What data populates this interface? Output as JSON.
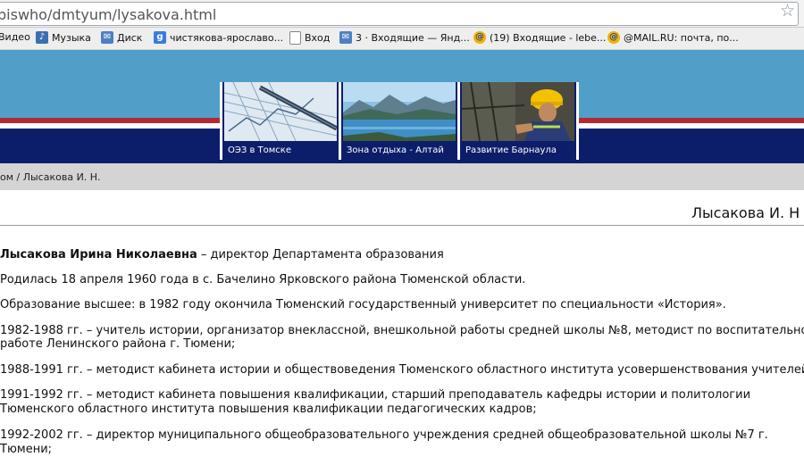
{
  "browser": {
    "url": "biswho/dmtyum/lysakova.html",
    "bookmarks": [
      {
        "label": "Видео",
        "icon": "video-icon"
      },
      {
        "label": "Музыка",
        "icon": "music-icon"
      },
      {
        "label": "Диск",
        "icon": "mail-icon"
      },
      {
        "label": "чистякова-ярославо...",
        "icon": "google-icon"
      },
      {
        "label": "Вход",
        "icon": "page-icon"
      },
      {
        "label": "3 · Входящие — Янд...",
        "icon": "mail-icon"
      },
      {
        "label": "(19) Входящие - lebe...",
        "icon": "at-icon"
      },
      {
        "label": "@MAIL.RU: почта, по...",
        "icon": "at-icon"
      }
    ]
  },
  "header": {
    "tiles": [
      {
        "caption": "ОЭЗ в Томске"
      },
      {
        "caption": "Зона отдыха - Алтай"
      },
      {
        "caption": "Развитие Барнаула"
      }
    ]
  },
  "breadcrumb": "ом / Лысакова И. Н.",
  "page": {
    "title": "Лысакова И. Н",
    "intro_name": "Лысакова Ирина Николаевна",
    "intro_rest": " – директор Департамента образования",
    "p1": "Родилась 18 апреля 1960 года в с. Бачелино Ярковского района Тюменской области.",
    "p2": "Образование высшее: в 1982 году окончила Тюменский государственный университет по специальности «История».",
    "p3a": "1982-1988 гг. – учитель истории, организатор внеклассной, внешкольной работы средней школы №8, методист по воспитательной",
    "p3b": "работе Ленинского района г. Тюмени;",
    "p4": "1988-1991 гг. – методист кабинета истории и обществоведения Тюменского областного института усовершенствования учителей;",
    "p5a": "1991-1992 гг. – методист кабинета повышения квалификации, старший преподаватель кафедры истории и политологии",
    "p5b": "Тюменского областного института повышения квалификации педагогических кадров;",
    "p6a": "1992-2002 гг. – директор муниципального общеобразовательного учреждения средней общеобразовательной школы №7 г.",
    "p6b": "Тюмени;"
  }
}
